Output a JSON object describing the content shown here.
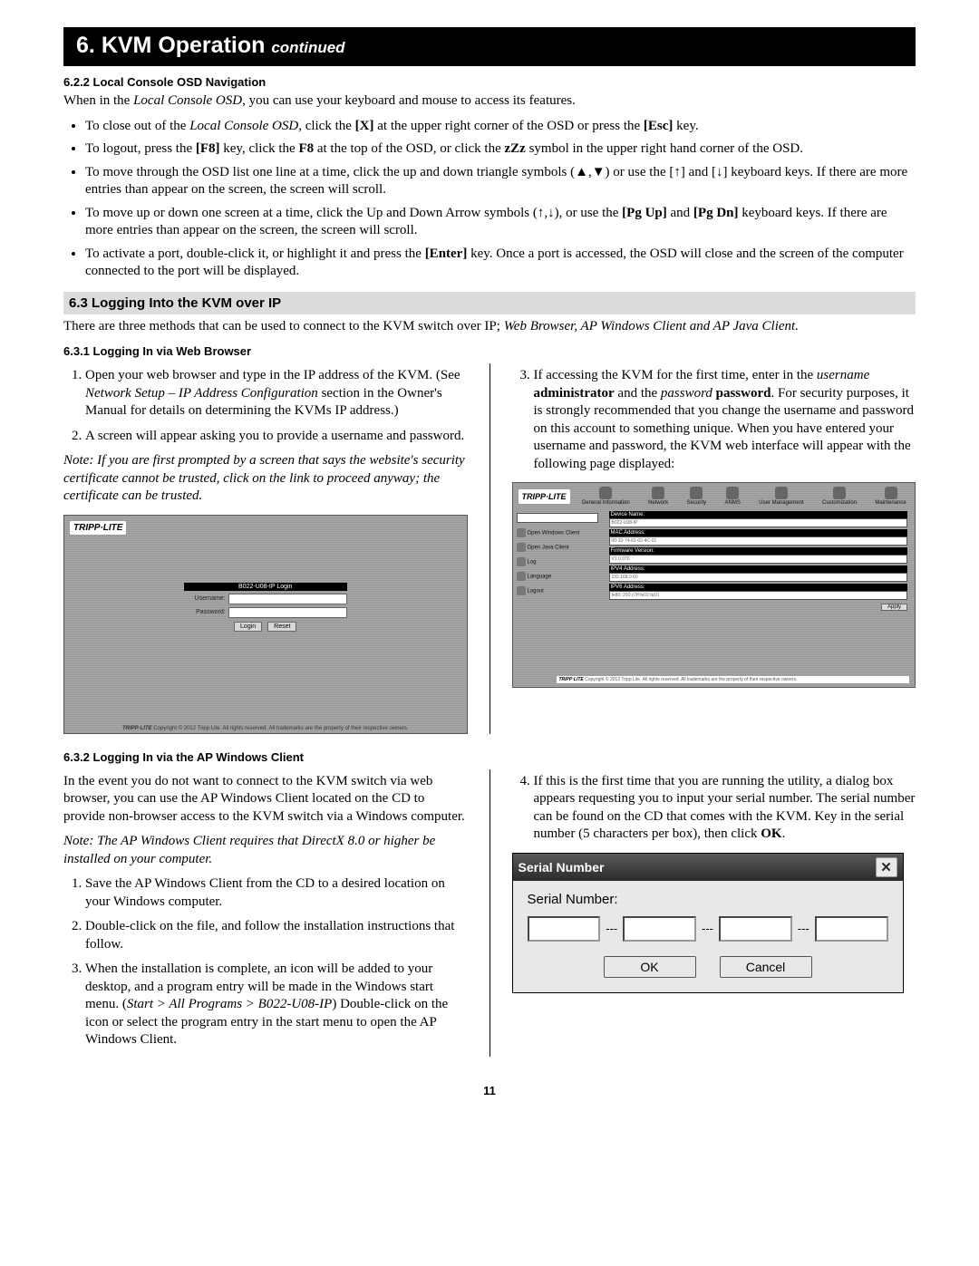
{
  "banner": {
    "num": "6.",
    "title": "KVM Operation",
    "cont": "continued"
  },
  "s622": {
    "title": "6.2.2 Local Console OSD Navigation",
    "intro_a": "When in the ",
    "intro_b": "Local Console OSD",
    "intro_c": ", you can use your keyboard and mouse to access its features.",
    "b1a": "To close out of the ",
    "b1b": "Local Console OSD",
    "b1c": ", click the ",
    "b1d": "[X]",
    "b1e": " at the upper right corner of the OSD or press the ",
    "b1f": "[Esc]",
    "b1g": " key.",
    "b2a": "To logout, press the ",
    "b2b": "[F8]",
    "b2c": " key, click the ",
    "b2d": "F8",
    "b2e": " at the top of the OSD, or click the ",
    "b2f": "zZz",
    "b2g": " symbol in the upper right hand corner of the OSD.",
    "b3a": "To move through the OSD list one line at a time, click the up and down triangle symbols (▲,▼) or use the [↑] and [↓] keyboard keys. If there are more entries than appear on the screen, the screen will scroll.",
    "b4a": "To move up or down one screen at a time, click the Up and Down Arrow symbols (↑,↓), or use the ",
    "b4b": "[Pg Up]",
    "b4c": " and ",
    "b4d": "[Pg Dn]",
    "b4e": " keyboard keys. If there are more entries than appear on the screen, the screen will scroll.",
    "b5a": "To activate a port, double-click it, or highlight it and press the ",
    "b5b": "[Enter]",
    "b5c": " key. Once a port is accessed, the OSD will close and the screen of the computer connected to the port will be displayed."
  },
  "s63": {
    "title": "6.3 Logging Into the KVM over IP",
    "intro_a": "There are three methods that can be used to connect to the KVM switch over IP; ",
    "intro_b": "Web Browser, AP Windows Client and AP Java Client."
  },
  "s631": {
    "title": "6.3.1 Logging In via Web Browser",
    "l1a": "Open your web browser and type in the IP address of the KVM. (See ",
    "l1b": "Network Setup – IP Address Configuration",
    "l1c": " section in the Owner's Manual for details on determining the KVMs IP address.)",
    "l2": "A screen will appear asking you to provide a username and password.",
    "note": "Note: If you are first prompted by a screen that says the website's security certificate cannot be trusted, click on the link to proceed anyway; the certificate can be trusted.",
    "r3a": "If accessing the KVM for the first time, enter in the ",
    "r3b": "username",
    "r3c": " ",
    "r3d": "administrator",
    "r3e": " and the ",
    "r3f": "password",
    "r3g": " ",
    "r3h": "password",
    "r3i": ". For security purposes, it is strongly recommended that you change the username and password on this account to something unique. When you have entered your username and password, the KVM web interface will appear with the following page displayed:"
  },
  "shot1": {
    "logo": "TRIPP·LITE",
    "title": "B022-U08-IP Login",
    "user": "Username:",
    "pass": "Password:",
    "login": "Login",
    "reset": "Reset",
    "foot_brand": "TRIPP·LITE",
    "foot_txt": " Copyright © 2012 Tripp Lite. All rights reserved. All trademarks are the property of their respective owners."
  },
  "shot2": {
    "logo": "TRIPP·LITE",
    "tabs": [
      "General Information",
      "Network",
      "Security",
      "ANMS",
      "User Management",
      "Customization",
      "Maintenance"
    ],
    "side": [
      "Open Windows Client",
      "Open Java Client",
      "Log",
      "Language",
      "Logout"
    ],
    "labels": [
      "Device Name:",
      "MAC Address:",
      "Firmware Version:",
      "IPV4 Address:",
      "IPV6 Address:"
    ],
    "vals": [
      "B022-U08-IP",
      "00-10-74-61-02-4C-01",
      "V1.0.070",
      "192.168.0.60",
      "fe80::200:c7ff:fe02:fa10"
    ],
    "apply": "Apply",
    "foot_brand": "TRIPP·LITE",
    "foot_txt": " Copyright © 2012 Tripp Lite. All rights reserved. All trademarks are the property of their respective owners."
  },
  "s632": {
    "title": "6.3.2 Logging In via the AP Windows Client",
    "pL": "In the event you do not want to connect to the KVM switch via web browser, you can use the AP Windows Client located on the CD to provide non-browser access to the KVM switch via a Windows computer.",
    "noteL": "Note: The AP Windows Client requires that DirectX 8.0 or higher be installed on your computer.",
    "l1": "Save the AP Windows Client from the CD to a desired location on your Windows computer.",
    "l2": "Double-click on the file, and follow the installation instructions that follow.",
    "l3a": "When the installation is complete, an icon will be added to your desktop, and a program entry will be made in the Windows start menu. (",
    "l3b": "Start > All Programs > B022-U08-IP",
    "l3c": ") Double-click on the icon or select the program entry in the start menu to open the AP Windows Client.",
    "r4a": "If this is the first time that you are running the utility, a dialog box appears requesting you to input your serial number. The serial number can be found on the CD that comes with the KVM. Key in the serial number (5 characters per box), then click ",
    "r4b": "OK",
    "r4c": "."
  },
  "serial": {
    "title": "Serial Number",
    "label": "Serial Number:",
    "ok": "OK",
    "cancel": "Cancel",
    "dash": "---"
  },
  "pagenum": "11"
}
